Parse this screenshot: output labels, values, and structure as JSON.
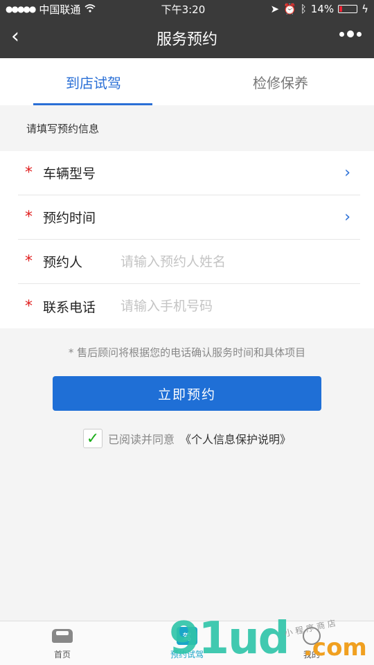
{
  "status_bar": {
    "carrier": "中国联通",
    "time": "下午3:20",
    "battery": "14%"
  },
  "nav": {
    "title": "服务预约"
  },
  "tabs": [
    {
      "label": "到店试驾",
      "active": true
    },
    {
      "label": "检修保养",
      "active": false
    }
  ],
  "form": {
    "hint": "请填写预约信息",
    "rows": [
      {
        "required": "*",
        "label": "车辆型号",
        "type": "select"
      },
      {
        "required": "*",
        "label": "预约时间",
        "type": "select"
      },
      {
        "required": "*",
        "label": "预约人",
        "placeholder": "请输入预约人姓名",
        "value": ""
      },
      {
        "required": "*",
        "label": "联系电话",
        "placeholder": "请输入手机号码",
        "value": ""
      }
    ]
  },
  "notice": "* 售后顾问将根据您的电话确认服务时间和具体项目",
  "submit_label": "立即预约",
  "agreement": {
    "checked": true,
    "text": "已阅读并同意",
    "link": "《个人信息保护说明》"
  },
  "tabbar": [
    {
      "label": "首页",
      "icon": "car-icon",
      "active": false
    },
    {
      "label": "预约试驾",
      "icon": "drive-icon",
      "active": true
    },
    {
      "label": "我的",
      "icon": "user-icon",
      "active": false
    }
  ],
  "drive_icon_glyph": "驾",
  "watermark": {
    "main": "91ud",
    "domain": ".com",
    "sub": "小 程 序 商 店"
  },
  "colors": {
    "accent": "#2a6fd6",
    "required": "#e02020",
    "navbar": "#3a3a3a",
    "tab_active": "#1aa5c8"
  }
}
